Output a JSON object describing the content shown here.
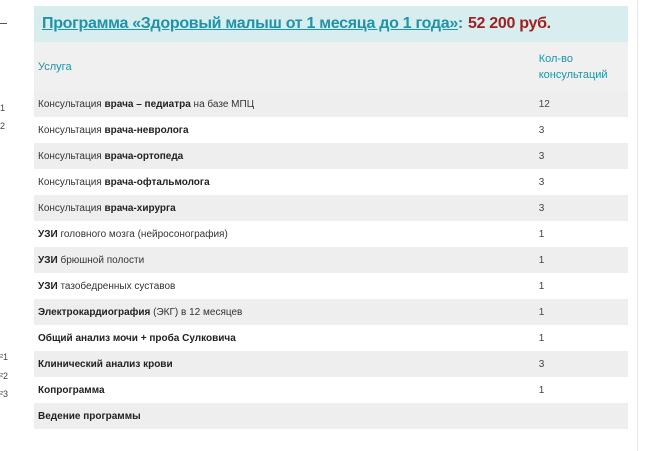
{
  "program": {
    "link_text": "Программа «Здоровый малыш от 1 месяца до 1 года»",
    "colon": ":",
    "price": "52 200 руб."
  },
  "table": {
    "headers": {
      "service": "Услуга",
      "count": "Кол-во консультаций"
    },
    "rows": [
      {
        "pre": "Консультация ",
        "bold": "врача – педиатра",
        "post": " на базе МПЦ",
        "count": "12"
      },
      {
        "pre": "Консультация ",
        "bold": "врача-невролога",
        "post": "",
        "count": "3"
      },
      {
        "pre": "Консультация ",
        "bold": "врача-ортопеда",
        "post": "",
        "count": "3"
      },
      {
        "pre": "Консультация ",
        "bold": "врача-офтальмолога",
        "post": "",
        "count": "3"
      },
      {
        "pre": "Консультация ",
        "bold": "врача-хирурга",
        "post": "",
        "count": "3"
      },
      {
        "pre": "",
        "bold": "УЗИ",
        "post": " головного мозга (нейросонография)",
        "count": "1"
      },
      {
        "pre": "",
        "bold": "УЗИ",
        "post": " брюшной полости",
        "count": "1"
      },
      {
        "pre": "",
        "bold": "УЗИ",
        "post": " тазобедренных суставов",
        "count": "1"
      },
      {
        "pre": "",
        "bold": "Электрокардиография",
        "post": " (ЭКГ) в 12 месяцев",
        "count": "1"
      },
      {
        "pre": "",
        "bold": "Общий анализ мочи + проба Сулковича",
        "post": "",
        "count": "1"
      },
      {
        "pre": "",
        "bold": "Клинический анализ крови",
        "post": "",
        "count": "3"
      },
      {
        "pre": "",
        "bold": "Копрограмма",
        "post": "",
        "count": "1"
      },
      {
        "pre": "",
        "bold": "Ведение программы",
        "post": "",
        "count": ""
      }
    ]
  },
  "margin_fragments": [
    "1",
    "2",
    "²1",
    "²2",
    "²3"
  ]
}
